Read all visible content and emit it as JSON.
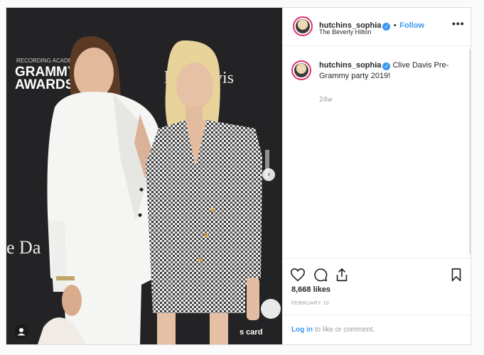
{
  "post": {
    "username": "hutchins_sophia",
    "follow_label": "Follow",
    "location": "The Beverly Hilton",
    "more_label": "•••",
    "caption_user": "hutchins_sophia",
    "caption_text": "Clive Davis Pre-Grammy party 2019!",
    "time_ago": "24w",
    "likes": "8,668 likes",
    "date": "FEBRUARY 10",
    "login_link": "Log in",
    "login_rest": " to like or comment."
  },
  "photo": {
    "backdrop_top_lines": [
      "RECORDING ACADEMY",
      "GRAMMY",
      "AWARDS"
    ],
    "backdrop_right_text": "live Davis",
    "backdrop_left_text": "e Da",
    "backdrop_bottom_text": "s card",
    "next_arrow": "›"
  },
  "colors": {
    "link_blue": "#3897f0",
    "border": "#dbdbdb",
    "backdrop": "#1f1f21"
  }
}
